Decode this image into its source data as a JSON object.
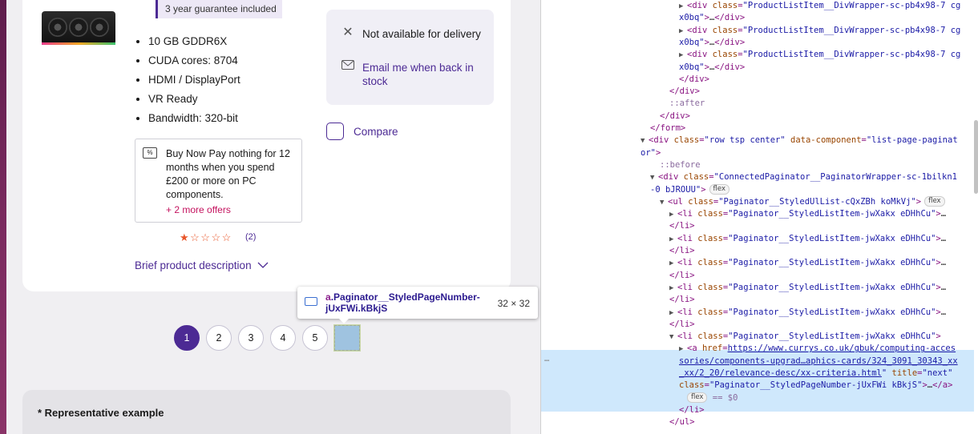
{
  "product": {
    "guarantee": "3 year guarantee included",
    "specs": [
      "10 GB GDDR6X",
      "CUDA cores: 8704",
      "HDMI / DisplayPort",
      "VR Ready",
      "Bandwidth: 320-bit"
    ],
    "delivery": "Not available for delivery",
    "email_back": "Email me when back in stock",
    "compare": "Compare",
    "offer_text": "Buy Now Pay nothing for 12 months when you spend £200 or more on PC components.",
    "offer_icon": "%",
    "more_offers": "+ 2 more offers",
    "stars": "★☆☆☆☆",
    "rating": 0.5,
    "review_count": "(2)",
    "brief": "Brief product description"
  },
  "pagination": {
    "pages": [
      "1",
      "2",
      "3",
      "4",
      "5"
    ],
    "active": "1"
  },
  "tooltip": {
    "tag": "a",
    "name": ".Paginator__StyledPageNumber-jUxFWi.kBkjS",
    "dims": "32 × 32"
  },
  "representative": "* Representative example",
  "devtools": {
    "lines": [
      {
        "indent": 50,
        "arrow": "▶",
        "parts": [
          [
            "tag",
            "<div "
          ],
          [
            "attr",
            "class"
          ],
          [
            "tag",
            "="
          ],
          [
            "val",
            "\"ProductListItem__DivWrapper-sc-pb4x98-7 cg"
          ]
        ]
      },
      {
        "indent": 50,
        "arrow": "",
        "parts": [
          [
            "val",
            "x0bq\""
          ],
          [
            "tag",
            ">"
          ],
          [
            "text",
            "…"
          ],
          [
            "tag",
            "</div>"
          ]
        ]
      },
      {
        "indent": 50,
        "arrow": "▶",
        "parts": [
          [
            "tag",
            "<div "
          ],
          [
            "attr",
            "class"
          ],
          [
            "tag",
            "="
          ],
          [
            "val",
            "\"ProductListItem__DivWrapper-sc-pb4x98-7 cg"
          ]
        ]
      },
      {
        "indent": 50,
        "arrow": "",
        "parts": [
          [
            "val",
            "x0bq\""
          ],
          [
            "tag",
            ">"
          ],
          [
            "text",
            "…"
          ],
          [
            "tag",
            "</div>"
          ]
        ]
      },
      {
        "indent": 50,
        "arrow": "▶",
        "parts": [
          [
            "tag",
            "<div "
          ],
          [
            "attr",
            "class"
          ],
          [
            "tag",
            "="
          ],
          [
            "val",
            "\"ProductListItem__DivWrapper-sc-pb4x98-7 cg"
          ]
        ]
      },
      {
        "indent": 50,
        "arrow": "",
        "parts": [
          [
            "val",
            "x0bq\""
          ],
          [
            "tag",
            ">"
          ],
          [
            "text",
            "…"
          ],
          [
            "tag",
            "</div>"
          ]
        ]
      },
      {
        "indent": 50,
        "arrow": "",
        "parts": [
          [
            "tag",
            "</div>"
          ]
        ]
      },
      {
        "indent": 38,
        "arrow": "",
        "parts": [
          [
            "tag",
            "</div>"
          ]
        ]
      },
      {
        "indent": 38,
        "arrow": "",
        "parts": [
          [
            "pseudo",
            "::after"
          ]
        ]
      },
      {
        "indent": 26,
        "arrow": "",
        "parts": [
          [
            "tag",
            "</div>"
          ]
        ]
      },
      {
        "indent": 14,
        "arrow": "",
        "parts": [
          [
            "tag",
            "</form>"
          ]
        ]
      },
      {
        "indent": 2,
        "arrow": "▼",
        "parts": [
          [
            "tag",
            "<div "
          ],
          [
            "attr",
            "class"
          ],
          [
            "tag",
            "="
          ],
          [
            "val",
            "\"row tsp center\" "
          ],
          [
            "attr",
            "data-component"
          ],
          [
            "tag",
            "="
          ],
          [
            "val",
            "\"list-page-paginat"
          ]
        ]
      },
      {
        "indent": 2,
        "arrow": "",
        "parts": [
          [
            "val",
            "or\""
          ],
          [
            "tag",
            ">"
          ]
        ]
      },
      {
        "indent": 26,
        "arrow": "",
        "parts": [
          [
            "pseudo",
            "::before"
          ]
        ]
      },
      {
        "indent": 14,
        "arrow": "▼",
        "parts": [
          [
            "tag",
            "<div "
          ],
          [
            "attr",
            "class"
          ],
          [
            "tag",
            "="
          ],
          [
            "val",
            "\"ConnectedPaginator__PaginatorWrapper-sc-1bilkn1"
          ]
        ]
      },
      {
        "indent": 14,
        "arrow": "",
        "parts": [
          [
            "val",
            "-0 bJROUU\""
          ],
          [
            "tag",
            ">"
          ],
          [
            "badge",
            "flex"
          ]
        ]
      },
      {
        "indent": 26,
        "arrow": "▼",
        "parts": [
          [
            "tag",
            "<ul "
          ],
          [
            "attr",
            "class"
          ],
          [
            "tag",
            "="
          ],
          [
            "val",
            "\"Paginator__StyledUlList-cQxZBh koMkVj\""
          ],
          [
            "tag",
            ">"
          ],
          [
            "badge",
            "flex"
          ]
        ]
      },
      {
        "indent": 38,
        "arrow": "▶",
        "parts": [
          [
            "tag",
            "<li "
          ],
          [
            "attr",
            "class"
          ],
          [
            "tag",
            "="
          ],
          [
            "val",
            "\"Paginator__StyledListItem-jwXakx eDHhCu\""
          ],
          [
            "tag",
            ">"
          ],
          [
            "text",
            "…"
          ]
        ]
      },
      {
        "indent": 38,
        "arrow": "",
        "parts": [
          [
            "tag",
            "</li>"
          ]
        ]
      },
      {
        "indent": 38,
        "arrow": "▶",
        "parts": [
          [
            "tag",
            "<li "
          ],
          [
            "attr",
            "class"
          ],
          [
            "tag",
            "="
          ],
          [
            "val",
            "\"Paginator__StyledListItem-jwXakx eDHhCu\""
          ],
          [
            "tag",
            ">"
          ],
          [
            "text",
            "…"
          ]
        ]
      },
      {
        "indent": 38,
        "arrow": "",
        "parts": [
          [
            "tag",
            "</li>"
          ]
        ]
      },
      {
        "indent": 38,
        "arrow": "▶",
        "parts": [
          [
            "tag",
            "<li "
          ],
          [
            "attr",
            "class"
          ],
          [
            "tag",
            "="
          ],
          [
            "val",
            "\"Paginator__StyledListItem-jwXakx eDHhCu\""
          ],
          [
            "tag",
            ">"
          ],
          [
            "text",
            "…"
          ]
        ]
      },
      {
        "indent": 38,
        "arrow": "",
        "parts": [
          [
            "tag",
            "</li>"
          ]
        ]
      },
      {
        "indent": 38,
        "arrow": "▶",
        "parts": [
          [
            "tag",
            "<li "
          ],
          [
            "attr",
            "class"
          ],
          [
            "tag",
            "="
          ],
          [
            "val",
            "\"Paginator__StyledListItem-jwXakx eDHhCu\""
          ],
          [
            "tag",
            ">"
          ],
          [
            "text",
            "…"
          ]
        ]
      },
      {
        "indent": 38,
        "arrow": "",
        "parts": [
          [
            "tag",
            "</li>"
          ]
        ]
      },
      {
        "indent": 38,
        "arrow": "▶",
        "parts": [
          [
            "tag",
            "<li "
          ],
          [
            "attr",
            "class"
          ],
          [
            "tag",
            "="
          ],
          [
            "val",
            "\"Paginator__StyledListItem-jwXakx eDHhCu\""
          ],
          [
            "tag",
            ">"
          ],
          [
            "text",
            "…"
          ]
        ]
      },
      {
        "indent": 38,
        "arrow": "",
        "parts": [
          [
            "tag",
            "</li>"
          ]
        ]
      },
      {
        "indent": 38,
        "arrow": "▼",
        "parts": [
          [
            "tag",
            "<li "
          ],
          [
            "attr",
            "class"
          ],
          [
            "tag",
            "="
          ],
          [
            "val",
            "\"Paginator__StyledListItem-jwXakx eDHhCu\""
          ],
          [
            "tag",
            ">"
          ]
        ]
      },
      {
        "indent": 50,
        "arrow": "▶",
        "parts": [
          [
            "tag",
            "<a "
          ],
          [
            "attr",
            "href"
          ],
          [
            "tag",
            "="
          ],
          [
            "link",
            "https://www.currys.co.uk/gbuk/computing-acces"
          ]
        ]
      },
      {
        "indent": 50,
        "arrow": "",
        "parts": [
          [
            "link",
            "sories/components-upgrad…aphics-cards/324_3091_30343_xx"
          ]
        ]
      },
      {
        "indent": 50,
        "arrow": "",
        "parts": [
          [
            "link",
            "_xx/2_20/relevance-desc/xx-criteria.html"
          ],
          [
            "val",
            "\" "
          ],
          [
            "attr",
            "title"
          ],
          [
            "tag",
            "="
          ],
          [
            "val",
            "\"next\""
          ]
        ]
      },
      {
        "indent": 50,
        "arrow": "",
        "parts": [
          [
            "attr",
            "class"
          ],
          [
            "tag",
            "="
          ],
          [
            "val",
            "\"Paginator__StyledPageNumber-jUxFWi kBkjS\""
          ],
          [
            "tag",
            ">"
          ],
          [
            "text",
            "…"
          ],
          [
            "tag",
            "</a>"
          ]
        ]
      },
      {
        "indent": 56,
        "arrow": "",
        "parts": [
          [
            "badge",
            "flex"
          ],
          [
            "pseudo",
            " == $0"
          ]
        ]
      },
      {
        "indent": 50,
        "arrow": "",
        "parts": [
          [
            "tag",
            "</li>"
          ]
        ]
      },
      {
        "indent": 38,
        "arrow": "",
        "parts": [
          [
            "tag",
            "</ul>"
          ]
        ]
      }
    ]
  }
}
